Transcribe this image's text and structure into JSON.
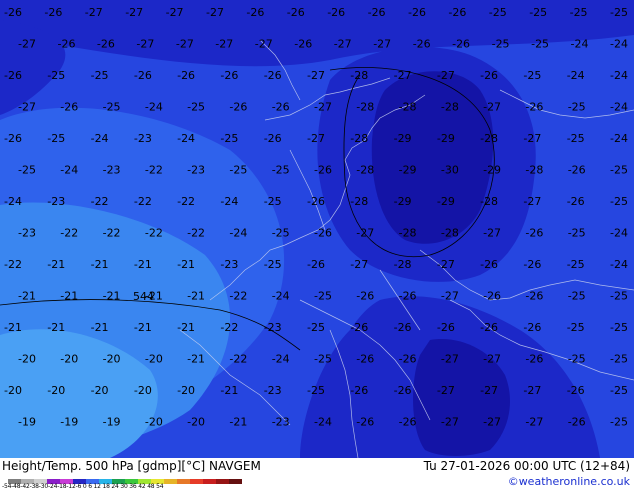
{
  "footer": {
    "left": "Height/Temp. 500 hPa [gdmp][°C] NAVGEM",
    "right_date": "Tu 27-01-2026 00:00 UTC (12+84)",
    "credit": "©weatheronline.co.uk"
  },
  "scale": {
    "labels": "-54-48-42-38-30-24-18-12-6  0  6  12 18 24 30 36 42 48 54",
    "colors": [
      "#7f7f7f",
      "#b0b0b0",
      "#d0d0d0",
      "#8a1ec8",
      "#c83cd6",
      "#2626c4",
      "#3a6af0",
      "#28b4e8",
      "#1ca050",
      "#3cc83c",
      "#a0e632",
      "#e6e632",
      "#e6b428",
      "#e67828",
      "#e63c28",
      "#c81e1e",
      "#961414",
      "#641010"
    ]
  },
  "map": {
    "palette": {
      "t_minus_29": "#1414a6",
      "t_minus_27": "#1c28c8",
      "t_minus_25": "#2646e0",
      "t_minus_23": "#2f62ec",
      "t_minus_21": "#3a86f0",
      "t_minus_19": "#4aa0f4"
    },
    "contour_label": "544",
    "temperature_labels": [
      [
        "-26",
        "-26",
        "-27",
        "-27",
        "-27",
        "-27",
        "-26",
        "-26",
        "-26",
        "-26",
        "-26",
        "-26",
        "-25",
        "-25",
        "-25",
        "-25"
      ],
      [
        "-27",
        "-26",
        "-26",
        "-27",
        "-27",
        "-27",
        "-27",
        "-26",
        "-27",
        "-27",
        "-26",
        "-26",
        "-25",
        "-25",
        "-24",
        "-24"
      ],
      [
        "-26",
        "-25",
        "-25",
        "-26",
        "-26",
        "-26",
        "-26",
        "-27",
        "-28",
        "-27",
        "-27",
        "-26",
        "-25",
        "-24",
        "-24"
      ],
      [
        "-27",
        "-26",
        "-25",
        "-24",
        "-25",
        "-26",
        "-26",
        "-27",
        "-28",
        "-28",
        "-28",
        "-27",
        "-26",
        "-25",
        "-24"
      ],
      [
        "-26",
        "-25",
        "-24",
        "-23",
        "-24",
        "-25",
        "-26",
        "-27",
        "-28",
        "-29",
        "-29",
        "-28",
        "-27",
        "-25",
        "-24"
      ],
      [
        "-25",
        "-24",
        "-23",
        "-22",
        "-23",
        "-25",
        "-25",
        "-26",
        "-28",
        "-29",
        "-30",
        "-29",
        "-28",
        "-26",
        "-25"
      ],
      [
        "-24",
        "-23",
        "-22",
        "-22",
        "-22",
        "-24",
        "-25",
        "-26",
        "-28",
        "-29",
        "-29",
        "-28",
        "-27",
        "-26",
        "-25"
      ],
      [
        "-23",
        "-22",
        "-22",
        "-22",
        "-22",
        "-24",
        "-25",
        "-26",
        "-27",
        "-28",
        "-28",
        "-27",
        "-26",
        "-25",
        "-24"
      ],
      [
        "-22",
        "-21",
        "-21",
        "-21",
        "-21",
        "-23",
        "-25",
        "-26",
        "-27",
        "-28",
        "-27",
        "-26",
        "-26",
        "-25",
        "-24"
      ],
      [
        "-21",
        "-21",
        "-21",
        "-21",
        "-21",
        "-22",
        "-24",
        "-25",
        "-26",
        "-26",
        "-27",
        "-26",
        "-26",
        "-25",
        "-25"
      ],
      [
        "-21",
        "-21",
        "-21",
        "-21",
        "-21",
        "-22",
        "-23",
        "-25",
        "-26",
        "-26",
        "-26",
        "-26",
        "-26",
        "-25",
        "-25"
      ],
      [
        "-20",
        "-20",
        "-20",
        "-20",
        "-21",
        "-22",
        "-24",
        "-25",
        "-26",
        "-26",
        "-27",
        "-27",
        "-26",
        "-25",
        "-25"
      ],
      [
        "-20",
        "-20",
        "-20",
        "-20",
        "-20",
        "-21",
        "-23",
        "-25",
        "-26",
        "-26",
        "-27",
        "-27",
        "-27",
        "-26",
        "-25"
      ],
      [
        "-19",
        "-19",
        "-19",
        "-20",
        "-20",
        "-21",
        "-23",
        "-24",
        "-26",
        "-26",
        "-27",
        "-27",
        "-27",
        "-26",
        "-25"
      ]
    ]
  }
}
